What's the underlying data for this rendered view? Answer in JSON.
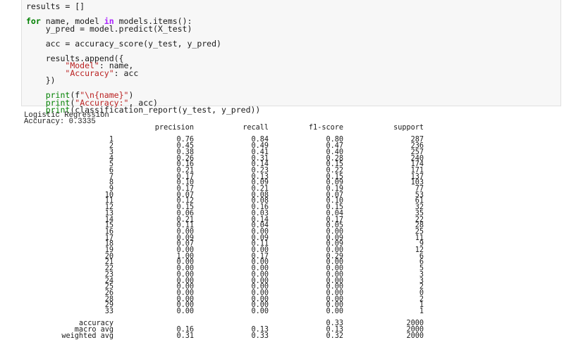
{
  "code_cell": {
    "lines": [
      [
        {
          "t": "results = []",
          "c": ""
        }
      ],
      [
        {
          "t": "",
          "c": ""
        }
      ],
      [
        {
          "t": "for",
          "c": "kw"
        },
        {
          "t": " name, model ",
          "c": ""
        },
        {
          "t": "in",
          "c": "kwp"
        },
        {
          "t": " models.items():",
          "c": ""
        }
      ],
      [
        {
          "t": "    y_pred = model.predict(X_test)",
          "c": ""
        }
      ],
      [
        {
          "t": "",
          "c": ""
        }
      ],
      [
        {
          "t": "    acc = accuracy_score(y_test, y_pred)",
          "c": ""
        }
      ],
      [
        {
          "t": "",
          "c": ""
        }
      ],
      [
        {
          "t": "    results.append({",
          "c": ""
        }
      ],
      [
        {
          "t": "        ",
          "c": ""
        },
        {
          "t": "\"Model\"",
          "c": "str"
        },
        {
          "t": ": name,",
          "c": ""
        }
      ],
      [
        {
          "t": "        ",
          "c": ""
        },
        {
          "t": "\"Accuracy\"",
          "c": "str"
        },
        {
          "t": ": acc",
          "c": ""
        }
      ],
      [
        {
          "t": "    })",
          "c": ""
        }
      ],
      [
        {
          "t": "",
          "c": ""
        }
      ],
      [
        {
          "t": "    ",
          "c": ""
        },
        {
          "t": "print",
          "c": "bi"
        },
        {
          "t": "(f",
          "c": ""
        },
        {
          "t": "\"\\n{name}\"",
          "c": "str"
        },
        {
          "t": ")",
          "c": ""
        }
      ],
      [
        {
          "t": "    ",
          "c": ""
        },
        {
          "t": "print",
          "c": "bi"
        },
        {
          "t": "(",
          "c": ""
        },
        {
          "t": "\"Accuracy:\"",
          "c": "str"
        },
        {
          "t": ", acc)",
          "c": ""
        }
      ],
      [
        {
          "t": "    ",
          "c": ""
        },
        {
          "t": "print",
          "c": "bi"
        },
        {
          "t": "(classification_report(y_test, y_pred))",
          "c": ""
        }
      ]
    ]
  },
  "output": {
    "model_name": "Logistic Regression",
    "accuracy_line": "Accuracy: 0.3335",
    "columns": [
      "",
      "precision",
      "recall",
      "f1-score",
      "support"
    ],
    "rows": [
      [
        "1",
        "0.76",
        "0.84",
        "0.80",
        "287"
      ],
      [
        "2",
        "0.45",
        "0.49",
        "0.47",
        "236"
      ],
      [
        "3",
        "0.38",
        "0.41",
        "0.40",
        "257"
      ],
      [
        "4",
        "0.26",
        "0.31",
        "0.28",
        "240"
      ],
      [
        "5",
        "0.16",
        "0.14",
        "0.15",
        "174"
      ],
      [
        "6",
        "0.21",
        "0.23",
        "0.22",
        "171"
      ],
      [
        "7",
        "0.17",
        "0.13",
        "0.15",
        "137"
      ],
      [
        "8",
        "0.10",
        "0.09",
        "0.09",
        "103"
      ],
      [
        "9",
        "0.17",
        "0.21",
        "0.19",
        "77"
      ],
      [
        "10",
        "0.07",
        "0.08",
        "0.07",
        "53"
      ],
      [
        "11",
        "0.12",
        "0.08",
        "0.10",
        "61"
      ],
      [
        "12",
        "0.15",
        "0.16",
        "0.15",
        "32"
      ],
      [
        "13",
        "0.06",
        "0.03",
        "0.04",
        "35"
      ],
      [
        "14",
        "0.21",
        "0.14",
        "0.17",
        "22"
      ],
      [
        "15",
        "0.11",
        "0.04",
        "0.05",
        "28"
      ],
      [
        "16",
        "0.00",
        "0.00",
        "0.00",
        "25"
      ],
      [
        "17",
        "0.09",
        "0.09",
        "0.09",
        "11"
      ],
      [
        "18",
        "0.07",
        "0.11",
        "0.09",
        "9"
      ],
      [
        "19",
        "0.00",
        "0.00",
        "0.00",
        "12"
      ],
      [
        "20",
        "1.00",
        "0.17",
        "0.29",
        "6"
      ],
      [
        "21",
        "0.00",
        "0.00",
        "0.00",
        "6"
      ],
      [
        "22",
        "0.00",
        "0.00",
        "0.00",
        "5"
      ],
      [
        "23",
        "0.00",
        "0.00",
        "0.00",
        "3"
      ],
      [
        "24",
        "0.00",
        "0.00",
        "0.00",
        "3"
      ],
      [
        "25",
        "0.00",
        "0.00",
        "0.00",
        "2"
      ],
      [
        "26",
        "0.00",
        "0.00",
        "0.00",
        "0"
      ],
      [
        "28",
        "0.00",
        "0.00",
        "0.00",
        "2"
      ],
      [
        "29",
        "0.00",
        "0.00",
        "0.00",
        "1"
      ],
      [
        "33",
        "0.00",
        "0.00",
        "0.00",
        "1"
      ]
    ],
    "summary": [
      [
        "accuracy",
        "",
        "",
        "0.33",
        "2000"
      ],
      [
        "macro avg",
        "0.16",
        "0.13",
        "0.13",
        "2000"
      ],
      [
        "weighted avg",
        "0.31",
        "0.33",
        "0.32",
        "2000"
      ]
    ]
  },
  "colors": {
    "keyword": "#008000",
    "keyword_in": "#aa22ff",
    "string": "#ba2121",
    "cell_background": "#f7f7f7"
  }
}
